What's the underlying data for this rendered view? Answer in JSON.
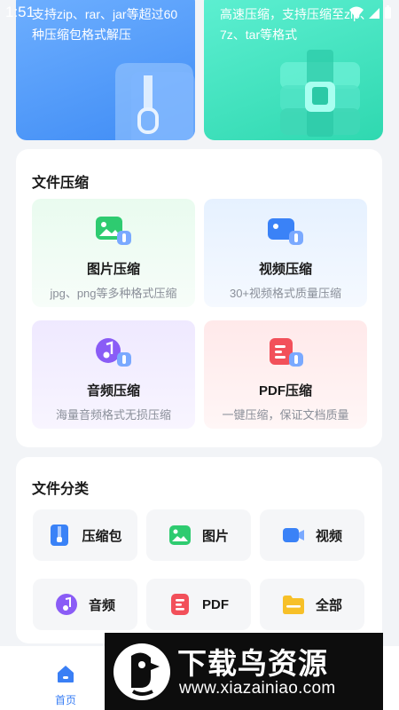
{
  "status_bar": {
    "time": "1:51"
  },
  "banners": {
    "left": {
      "text": "支持zip、rar、jar等超过60种压缩包格式解压",
      "color": "#4a95f7"
    },
    "right": {
      "text": "高速压缩，支持压缩至zip、7z、tar等格式",
      "color": "#34dcb6"
    }
  },
  "compress_section": {
    "title": "文件压缩",
    "tools": [
      {
        "name": "图片压缩",
        "desc": "jpg、png等多种格式压缩",
        "icon": "image-compress-icon",
        "color": "#2ecb70"
      },
      {
        "name": "视频压缩",
        "desc": "30+视频格式质量压缩",
        "icon": "video-compress-icon",
        "color": "#3a82f7"
      },
      {
        "name": "音频压缩",
        "desc": "海量音频格式无损压缩",
        "icon": "audio-compress-icon",
        "color": "#8a5cf6"
      },
      {
        "name": "PDF压缩",
        "desc": "一键压缩，保证文档质量",
        "icon": "pdf-compress-icon",
        "color": "#f2505a"
      }
    ]
  },
  "category_section": {
    "title": "文件分类",
    "items": [
      {
        "label": "压缩包",
        "icon": "archive-icon",
        "color": "#3a82f7"
      },
      {
        "label": "图片",
        "icon": "image-icon",
        "color": "#2ecb70"
      },
      {
        "label": "视频",
        "icon": "video-icon",
        "color": "#3a82f7"
      },
      {
        "label": "音频",
        "icon": "audio-icon",
        "color": "#8a5cf6"
      },
      {
        "label": "PDF",
        "icon": "pdf-icon",
        "color": "#f2505a"
      },
      {
        "label": "全部",
        "icon": "folder-icon",
        "color": "#f7c028"
      }
    ]
  },
  "bottom_nav": {
    "home_label": "首页",
    "accent": "#3a7ff5"
  },
  "watermark": {
    "brand": "下载鸟资源",
    "url": "www.xiazainiao.com"
  }
}
